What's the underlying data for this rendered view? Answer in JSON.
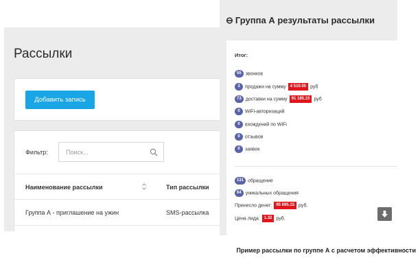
{
  "mailings_page": {
    "title": "Рассылки",
    "add_button_label": "Добавить запись",
    "filter": {
      "label": "Фильтр:",
      "placeholder": "Поиск...",
      "value": ""
    },
    "table": {
      "columns": [
        "Наименование рассылки",
        "Тип рассылки"
      ],
      "rows": [
        {
          "name": "Группа А - приглашение на ужин",
          "type": "SMS-рассылка"
        }
      ]
    }
  },
  "results": {
    "back_icon": "back-arrow-circle",
    "title": "Группа А результаты рассылки",
    "summary_label": "Итог:",
    "stats": [
      {
        "count": "55",
        "text": "звонков"
      },
      {
        "count": "3",
        "text_before": "продажи на сумму",
        "amount": "4 510.00",
        "text_after": "руб"
      },
      {
        "count": "73",
        "text_before": "доставки на сумму",
        "amount": "91 185.15",
        "text_after": "руб"
      },
      {
        "count": "0",
        "text": "WiFi-авторизаций"
      },
      {
        "count": "0",
        "text": "вхождений по WiFi"
      },
      {
        "count": "0",
        "text": "отзывов"
      },
      {
        "count": "0",
        "text": "заявок"
      }
    ],
    "appeals": {
      "count": "131",
      "text": "обращение"
    },
    "unique_appeals": {
      "count": "64",
      "text": "уникальных обращения"
    },
    "revenue": {
      "label": "Принесло денег:",
      "amount": "95 695.15",
      "unit": "руб."
    },
    "lead_price": {
      "label": "Цена лида:",
      "amount": "1.32",
      "unit": "руб."
    },
    "download_icon": "download-arrow"
  },
  "caption": "Пример рассылки по группе А с расчетом эффективности",
  "colors": {
    "panel_bg": "#ececec",
    "primary_button": "#1aa6e6",
    "badge": "#5b63a8",
    "money_badge": "#e0161c",
    "download_button": "#6c6c6c"
  }
}
